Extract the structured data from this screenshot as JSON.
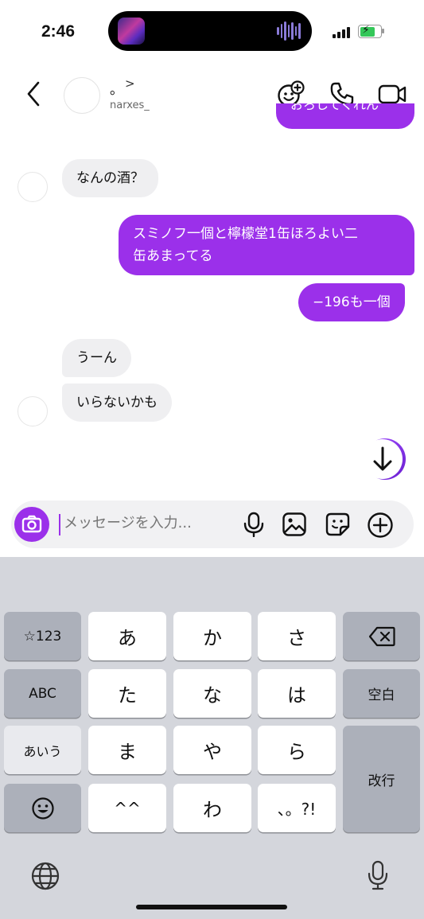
{
  "status_bar": {
    "time": "2:46"
  },
  "header": {
    "name": "。",
    "username": "narxes_"
  },
  "messages": {
    "partial_top": "おろしてくれん",
    "m1": "なんの酒？",
    "m2_line1": "スミノフ一個と檸檬堂1缶ほろよい二",
    "m2_line2": "缶あまってる",
    "m3": "−196も一個",
    "m4": "うーん",
    "m5": "いらないかも"
  },
  "composer": {
    "placeholder": "メッセージを入力..."
  },
  "keyboard": {
    "symbols_label": "☆123",
    "abc_label": "ABC",
    "kana_label": "あいう",
    "emoji_label": "☺",
    "keys": [
      "あ",
      "か",
      "さ",
      "た",
      "な",
      "は",
      "ま",
      "や",
      "ら",
      "^^",
      "わ",
      "、。?!"
    ],
    "space_label": "空白",
    "return_label": "改行"
  },
  "colors": {
    "accent": "#9b30ea",
    "received_bubble": "#efeff1",
    "keyboard_bg": "#d4d6dc"
  }
}
